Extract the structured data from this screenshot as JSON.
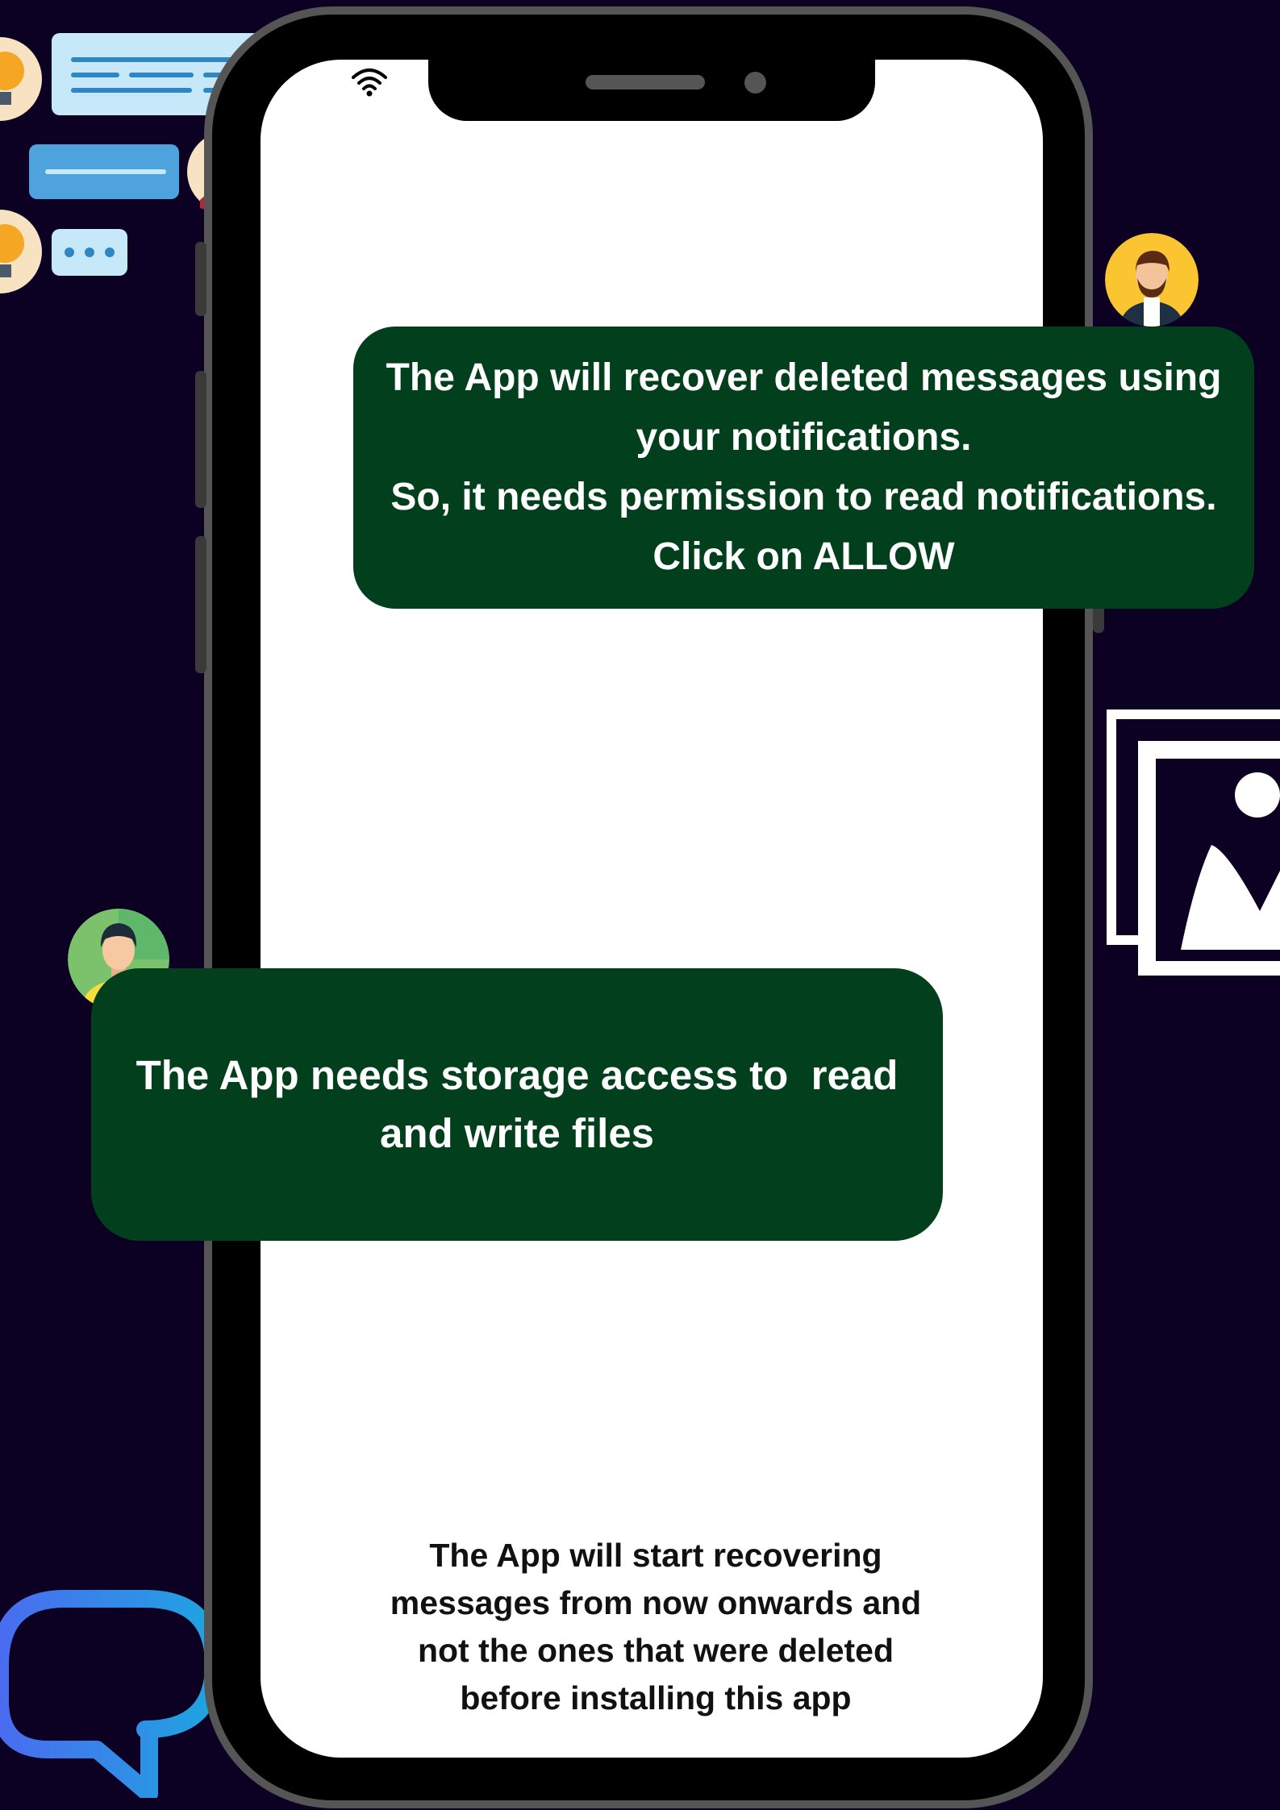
{
  "colors": {
    "background": "#0c0122",
    "phone_frame": "#000000",
    "phone_bezel": "#555555",
    "screen": "#ffffff",
    "bubble": "#023f1d",
    "bubble_text": "#ffffff",
    "body_text": "#111111",
    "chat_icon_gradient": [
      "#4a6cf0",
      "#1fa4e0"
    ]
  },
  "icons": {
    "wifi": "wifi-icon",
    "chat_outline": "chat-bubble-icon",
    "image": "image-icon",
    "lightbulb": "lightbulb-icon",
    "user": "user-icon"
  },
  "permission_bubbles": [
    {
      "lines": [
        "The App will recover deleted messages using",
        "your notifications.",
        "So, it needs permission to read notifications.",
        "Click on ALLOW"
      ]
    },
    {
      "lines": [
        "The App needs storage access to  read",
        "and write files"
      ]
    }
  ],
  "footer_note": {
    "lines": [
      "The App will start recovering",
      "messages from now onwards and",
      "not the ones that were deleted",
      "before installing this app"
    ]
  }
}
